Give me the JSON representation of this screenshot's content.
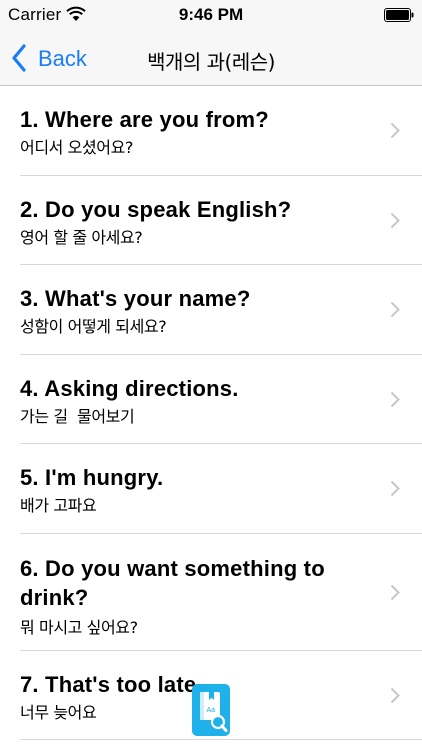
{
  "status_bar": {
    "carrier": "Carrier",
    "time": "9:46 PM"
  },
  "nav": {
    "back_label": "Back",
    "title": "백개의 과(레슨)"
  },
  "lessons": [
    {
      "title": "1. Where are you from?",
      "subtitle": "어디서 오셨어요?"
    },
    {
      "title": "2. Do you speak English?",
      "subtitle": "영어 할 줄 아세요?"
    },
    {
      "title": "3. What's your name?",
      "subtitle": "성함이 어떻게 되세요?"
    },
    {
      "title": "4. Asking directions.",
      "subtitle": "가는 길  물어보기"
    },
    {
      "title": "5. I'm hungry.",
      "subtitle": "배가 고파요"
    },
    {
      "title": "6. Do you want something to drink?",
      "subtitle": "뭐 마시고 싶어요?"
    },
    {
      "title": "7. That's too late.",
      "subtitle": "너무 늦어요"
    }
  ],
  "dictionary_badge": {
    "label": "Aa",
    "icon": "dictionary-search-icon"
  },
  "colors": {
    "accent": "#1a7df7",
    "bar_background": "#f7f7f7",
    "divider": "#d8d8dc",
    "chevron": "#c7c7cc",
    "badge": "#1fb1ea"
  }
}
